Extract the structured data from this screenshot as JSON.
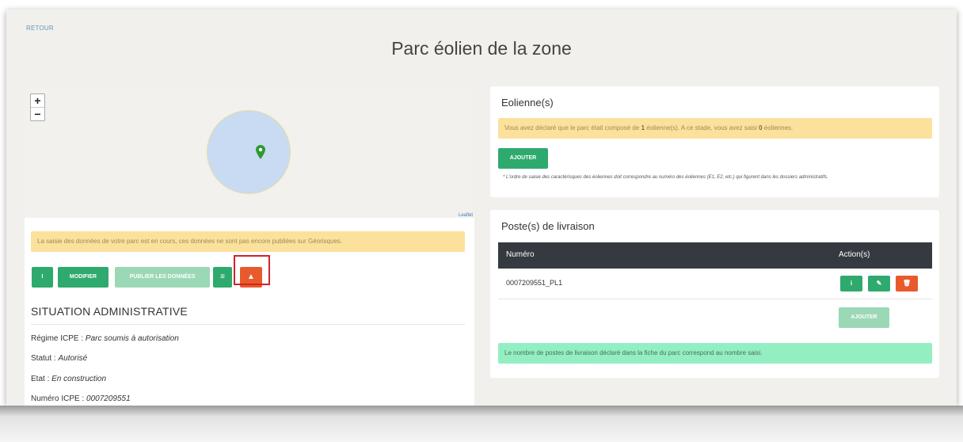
{
  "nav": {
    "back_label": "RETOUR"
  },
  "page": {
    "title": "Parc éolien de la zone"
  },
  "map": {
    "zoom_in": "+",
    "zoom_out": "−",
    "attribution": "Leaflet",
    "circle_color": "#c9daf3",
    "marker_color": "#2e9a2e"
  },
  "left": {
    "warning": "La saisie des données de votre parc est en cours, ces données ne sont pas encore publiées sur Géorisques.",
    "buttons": {
      "info": "i",
      "modifier": "MODIFIER",
      "publier": "PUBLIER LES DONNÉES",
      "menu": "≡",
      "alert": "▲"
    },
    "situation": {
      "title": "SITUATION ADMINISTRATIVE",
      "items": [
        {
          "label": "Régime ICPE : ",
          "value": "Parc soumis à autorisation"
        },
        {
          "label": "Statut : ",
          "value": "Autorisé"
        },
        {
          "label": "Etat : ",
          "value": "En construction"
        },
        {
          "label": "Numéro ICPE : ",
          "value": "0007209551"
        }
      ]
    }
  },
  "eoliennes": {
    "title": "Eolienne(s)",
    "warning_pre": "Vous avez déclaré que le parc était composé de ",
    "declared": "1",
    "warning_mid": " éolienne(s). A ce stade, vous avez saisi ",
    "entered": "0",
    "warning_post": " éoliennes.",
    "add_label": "AJOUTER",
    "note": "* L'ordre de saisie des caractérisques des éoliennes doit correspondre au numéro des éoliennes (E1, E2, etc.) qui figurent dans les dossiers administratifs."
  },
  "postes": {
    "title": "Poste(s) de livraison",
    "columns": [
      "Numéro",
      "Action(s)"
    ],
    "rows": [
      {
        "numero": "0007209551_PL1"
      }
    ],
    "row_actions": {
      "info": "i",
      "edit": "✎",
      "delete": "🗑"
    },
    "add_label": "AJOUTER",
    "success": "Le nombre de postes de livraison déclaré dans la fiche du parc correspond au nombre saisi."
  },
  "colors": {
    "primary": "#2faa6e",
    "primary_disabled": "#9bd8b5",
    "danger": "#e85a2c",
    "warning_bg": "#fbe19c",
    "success_bg": "#93efc2",
    "table_head": "#343a40",
    "highlight": "#d1232a"
  }
}
